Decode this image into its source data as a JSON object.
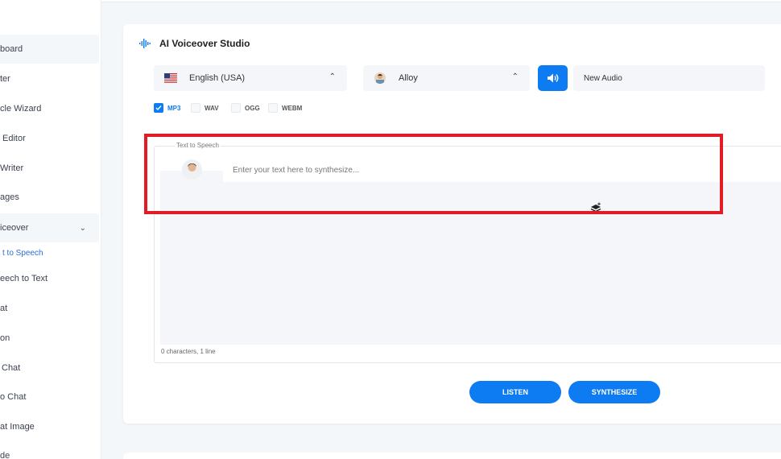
{
  "sidebar": {
    "items": [
      {
        "label": "board"
      },
      {
        "label": "ter"
      },
      {
        "label": "cle Wizard"
      },
      {
        "label": "Editor"
      },
      {
        "label": "Writer"
      },
      {
        "label": "ages"
      },
      {
        "label": "iceover"
      },
      {
        "label": "eech to Text"
      },
      {
        "label": "at"
      },
      {
        "label": "on"
      },
      {
        "label": "Chat"
      },
      {
        "label": "o Chat"
      },
      {
        "label": "at Image"
      },
      {
        "label": "de"
      }
    ],
    "submenu_active": "t to Speech"
  },
  "studio": {
    "title": "AI Voiceover Studio",
    "language": "English (USA)",
    "voice": "Alloy",
    "name_value": "New Audio",
    "formats": [
      {
        "label": "MP3",
        "checked": true
      },
      {
        "label": "WAV",
        "checked": false
      },
      {
        "label": "OGG",
        "checked": false
      },
      {
        "label": "WEBM",
        "checked": false
      }
    ],
    "text_section_label": "Text to Speech",
    "text_placeholder": "Enter your text here to synthesize...",
    "char_count": "0 characters, 1 line",
    "listen_label": "LISTEN",
    "synthesize_label": "SYNTHESIZE"
  },
  "colors": {
    "accent": "#0d7bf2",
    "highlight": "#e21b25",
    "background": "#f4f7fa"
  },
  "icons": {
    "title": "waveform-icon",
    "language": "us-flag-icon",
    "speaker": "speaker-icon",
    "layers": "layers-icon"
  }
}
